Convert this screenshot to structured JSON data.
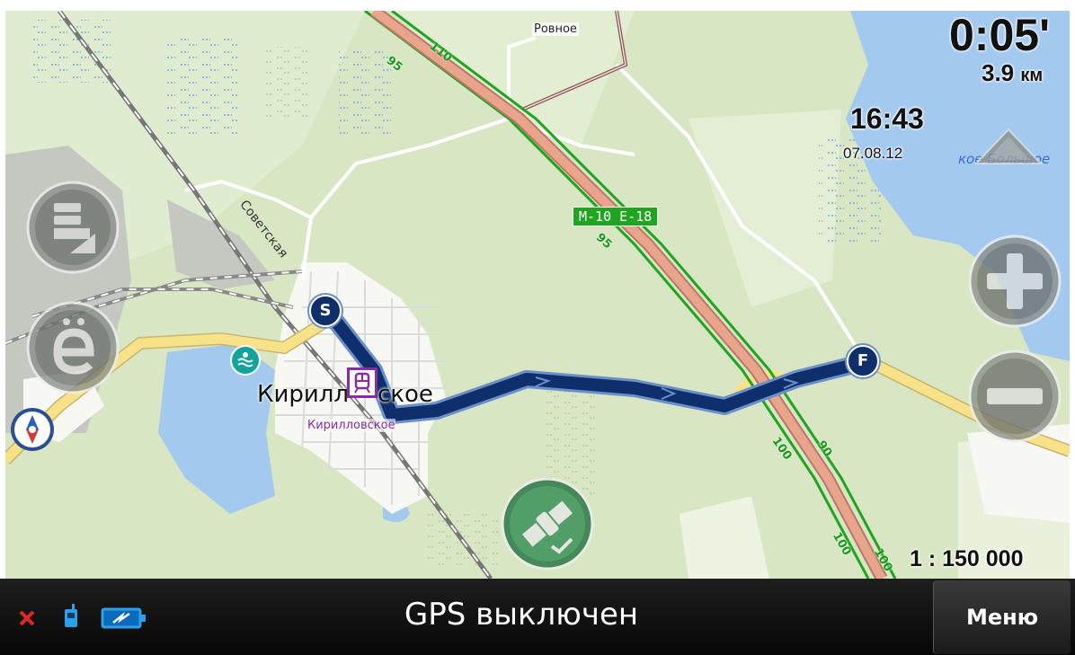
{
  "map": {
    "places": {
      "rovnoe": "Ровное",
      "kirillovskoe_main_left": "Кирилл",
      "kirillovskoe_main_right": "ское",
      "kirillovskoe_small": "Кирилловское",
      "lake": "кое Большое"
    },
    "streets": {
      "sovetskaya": "Советская"
    },
    "road": {
      "shield": "M-10 E-18"
    },
    "km_markers": [
      "95",
      "110",
      "95",
      "100",
      "90",
      "100",
      "100"
    ],
    "route": {
      "start_marker": "S",
      "finish_marker": "F"
    }
  },
  "hud": {
    "time_remaining": "0:05'",
    "distance": "3.9",
    "distance_unit": "км",
    "clock": "16:43",
    "date": "07.08.12",
    "scale": "1 : 150 000"
  },
  "status_bar": {
    "gps_status": "GPS выключен",
    "menu_label": "Меню"
  },
  "colors": {
    "map_background": "#d9e6c4",
    "water": "#a3c9ee",
    "route": "#0e2f6b",
    "main_road": "#e9a58c",
    "highway_border": "#1fa51f",
    "yellow_road": "#f7e28a",
    "city_area": "#ffffff",
    "status_bar": "#111111"
  },
  "icons": [
    "gps-off-x-icon",
    "device-icon",
    "battery-charging-icon",
    "compass-icon",
    "layers-icon",
    "poi-icon",
    "satellite-icon",
    "zoom-in-icon",
    "zoom-out-icon",
    "tilt-up-icon",
    "railway-station-icon",
    "beach-icon"
  ]
}
